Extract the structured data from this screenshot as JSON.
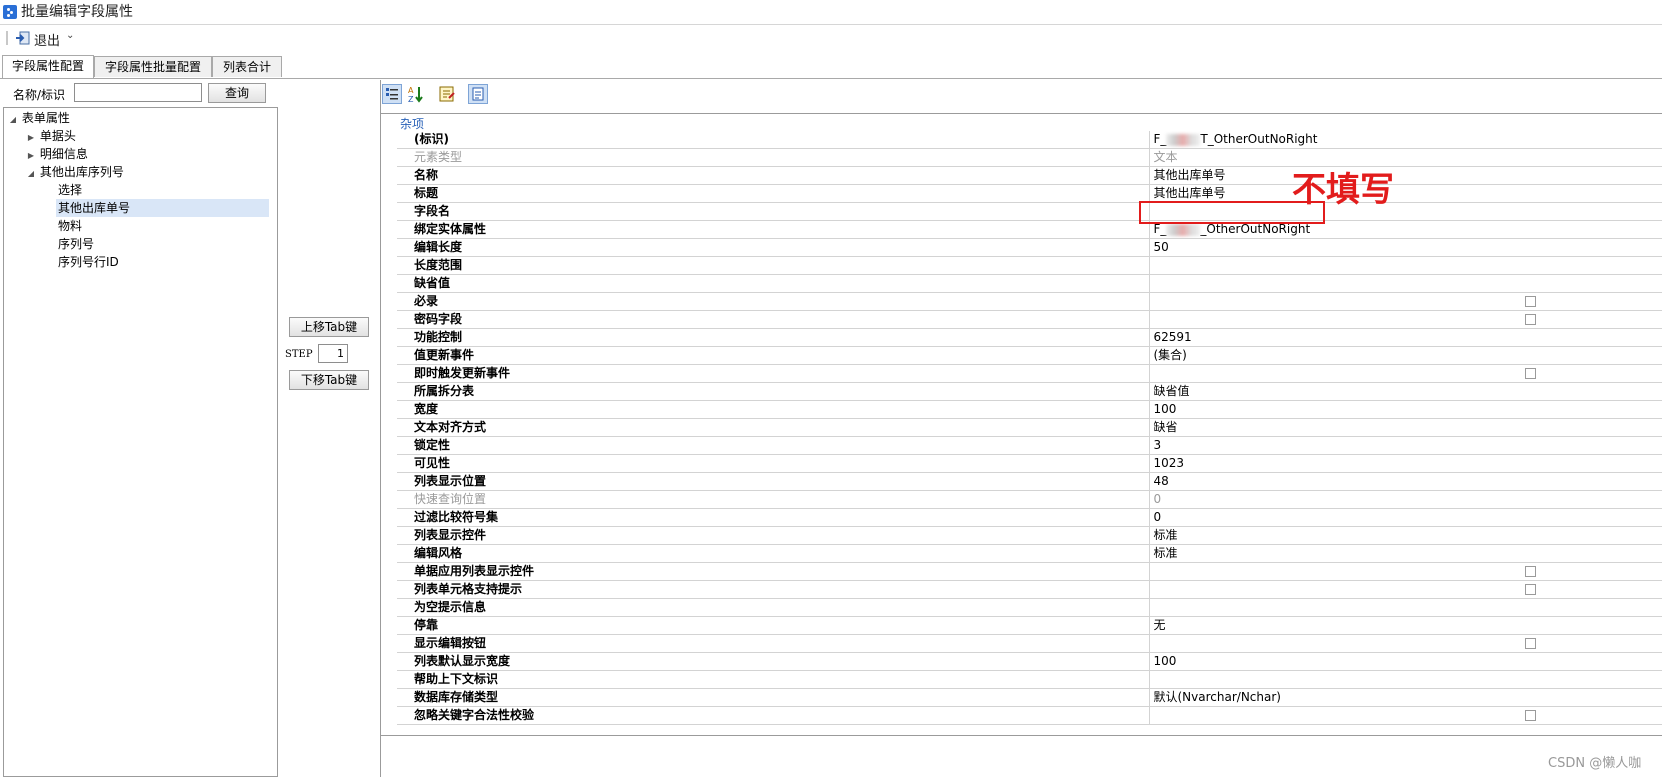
{
  "window": {
    "title": "批量编辑字段属性"
  },
  "toolbar": {
    "exit_label": "退出"
  },
  "tabs": [
    {
      "label": "字段属性配置",
      "active": true
    },
    {
      "label": "字段属性批量配置",
      "active": false
    },
    {
      "label": "列表合计",
      "active": false
    }
  ],
  "search": {
    "label": "名称/标识",
    "value": "",
    "button": "查询"
  },
  "tree": {
    "root": "表单属性",
    "nodes": [
      {
        "label": "单据头",
        "level": 1,
        "toggle": "▶"
      },
      {
        "label": "明细信息",
        "level": 1,
        "toggle": "▶"
      },
      {
        "label": "其他出库序列号",
        "level": 1,
        "toggle": "◢"
      },
      {
        "label": "选择",
        "level": 2
      },
      {
        "label": "其他出库单号",
        "level": 2,
        "selected": true
      },
      {
        "label": "物料",
        "level": 2
      },
      {
        "label": "序列号",
        "level": 2
      },
      {
        "label": "序列号行ID",
        "level": 2
      }
    ]
  },
  "middle": {
    "move_up": "上移Tab键",
    "step_label": "STEP",
    "step_value": "1",
    "move_down": "下移Tab键"
  },
  "grid": {
    "category": "杂项",
    "rows": [
      {
        "name": "(标识)",
        "value_prefix": "F_",
        "value": "T_OtherOutNoRight",
        "blurred": true
      },
      {
        "name": "元素类型",
        "value": "文本",
        "disabled": true
      },
      {
        "name": "名称",
        "value": "其他出库单号"
      },
      {
        "name": "标题",
        "value": "其他出库单号"
      },
      {
        "name": "字段名",
        "value": ""
      },
      {
        "name": "绑定实体属性",
        "value_prefix": "F_",
        "value": "_OtherOutNoRight",
        "blurred": true
      },
      {
        "name": "编辑长度",
        "value": "50"
      },
      {
        "name": "长度范围",
        "value": ""
      },
      {
        "name": "缺省值",
        "value": ""
      },
      {
        "name": "必录",
        "value": "",
        "checkbox": true
      },
      {
        "name": "密码字段",
        "value": "",
        "checkbox": true
      },
      {
        "name": "功能控制",
        "value": "62591"
      },
      {
        "name": "值更新事件",
        "value": "(集合)"
      },
      {
        "name": "即时触发更新事件",
        "value": "",
        "checkbox": true
      },
      {
        "name": "所属拆分表",
        "value": "缺省值"
      },
      {
        "name": "宽度",
        "value": "100"
      },
      {
        "name": "文本对齐方式",
        "value": "缺省"
      },
      {
        "name": "锁定性",
        "value": "3"
      },
      {
        "name": "可见性",
        "value": "1023"
      },
      {
        "name": "列表显示位置",
        "value": "48"
      },
      {
        "name": "快速查询位置",
        "value": "0",
        "disabled": true
      },
      {
        "name": "过滤比较符号集",
        "value": "0"
      },
      {
        "name": "列表显示控件",
        "value": "标准"
      },
      {
        "name": "编辑风格",
        "value": "标准"
      },
      {
        "name": "单据应用列表显示控件",
        "value": "",
        "checkbox": true
      },
      {
        "name": "列表单元格支持提示",
        "value": "",
        "checkbox": true
      },
      {
        "name": "为空提示信息",
        "value": ""
      },
      {
        "name": "停靠",
        "value": "无"
      },
      {
        "name": "显示编辑按钮",
        "value": "",
        "checkbox": true
      },
      {
        "name": "列表默认显示宽度",
        "value": "100"
      },
      {
        "name": "帮助上下文标识",
        "value": ""
      },
      {
        "name": "数据库存储类型",
        "value": "默认(Nvarchar/Nchar)"
      },
      {
        "name": "忽略关键字合法性校验",
        "value": "",
        "checkbox": true
      }
    ]
  },
  "annotation": {
    "text": "不填写",
    "color": "#e21c1c"
  },
  "watermark": "CSDN @懒人咖",
  "colors": {
    "accent": "#2a6fd6",
    "selection": "#d9e6f7",
    "category": "#2a62b8"
  },
  "icons": [
    "app-icon",
    "exit-icon",
    "chevron-down-icon",
    "sort-categorized-icon",
    "sort-alphabetical-icon",
    "property-pages-icon",
    "properties-icon"
  ]
}
